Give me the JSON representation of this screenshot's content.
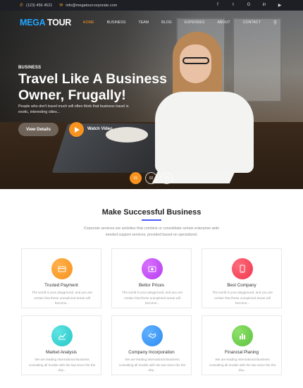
{
  "topbar": {
    "phone": "(123) 456 4521",
    "email": "info@megatourcorporate.com",
    "socials": [
      "facebook-icon",
      "twitter-icon",
      "google-plus-icon",
      "linkedin-icon",
      "youtube-icon"
    ]
  },
  "nav": {
    "logo_part1": "MEGA",
    "logo_part2": "TOUR",
    "items": [
      {
        "label": "HOME",
        "active": true
      },
      {
        "label": "BUSINESS"
      },
      {
        "label": "TEAM"
      },
      {
        "label": "BLOG"
      },
      {
        "label": "EXPENSES"
      },
      {
        "label": "ABOUT"
      },
      {
        "label": "CONTACT"
      }
    ]
  },
  "hero": {
    "tag": "BUSINESS",
    "title": "Travel Like A Business Owner, Frugally!",
    "lead": "People who don't travel much will often think that business travel is exotic, interesting cities...",
    "view_details": "View Details",
    "watch_video": "Watch Video",
    "slides": [
      "01",
      "02",
      "03"
    ],
    "active_slide": "01"
  },
  "section": {
    "title": "Make Successful Business",
    "description": "Corporate services are activities that combine or consolidate certain enterprise wide needed support services, provided based on specialized."
  },
  "cards": [
    {
      "title": "Trusted Payment",
      "text": "The world is your playground, and you are certain that these unexplored areas will become...",
      "icon": "credit-card-icon",
      "color": "#f7931e"
    },
    {
      "title": "Bettor Prices",
      "text": "The world is your playground, and you are certain that these unexplored areas will become...",
      "icon": "dollar-icon",
      "color": "#b63cf0"
    },
    {
      "title": "Best Company",
      "text": "The world is your playground, and you are certain that these unexplored areas will become...",
      "icon": "tablet-icon",
      "color": "#f0374d"
    },
    {
      "title": "Market Analysis",
      "text": "We are leading International Business consulting all trouble with the law since the the day...",
      "icon": "chart-icon",
      "color": "#27c7c7"
    },
    {
      "title": "Company Incorporation",
      "text": "We are leading International Business consulting all trouble with the law since the the day...",
      "icon": "handshake-icon",
      "color": "#2d8cf0"
    },
    {
      "title": "Financial Planing",
      "text": "We are leading International Business consulting all trouble with the law since the the day...",
      "icon": "bar-chart-icon",
      "color": "#5cc33f"
    }
  ]
}
